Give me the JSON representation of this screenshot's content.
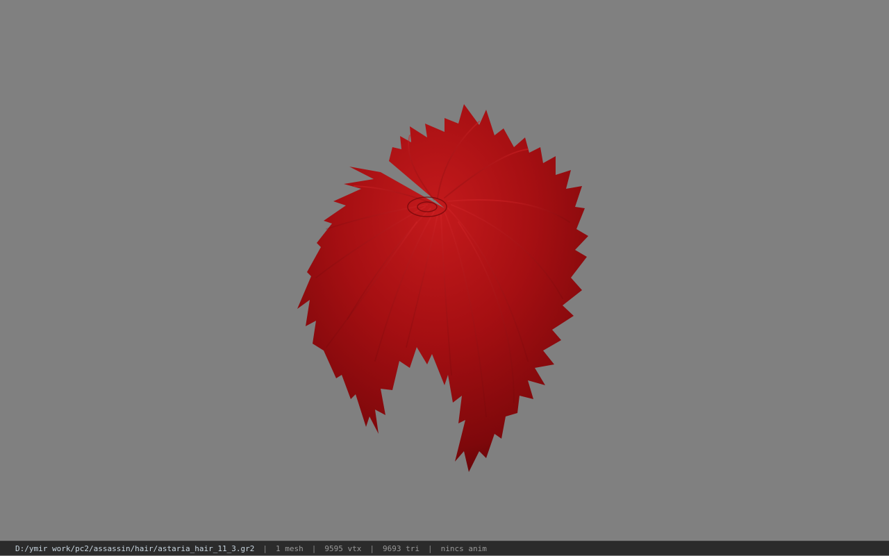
{
  "viewport": {
    "background_color": "#808080",
    "model_color": "#a50f12",
    "model_icon": "hair-mesh"
  },
  "statusbar": {
    "file_path": "D:/ymir work/pc2/assassin/hair/astaria_hair_11_3.gr2",
    "separator": "|",
    "mesh_count": "1 mesh",
    "vertex_count": "9595 vtx",
    "triangle_count": "9693 tri",
    "anim_status": "nincs anim"
  }
}
